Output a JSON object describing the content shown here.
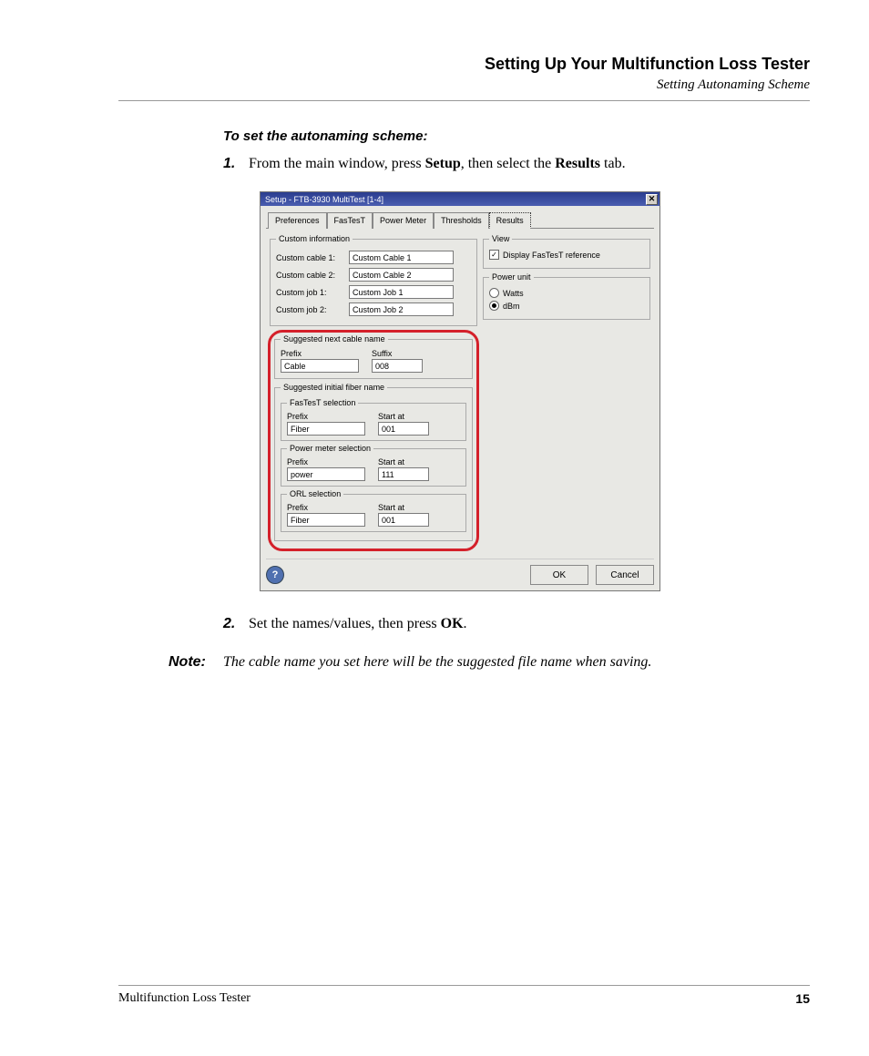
{
  "header": {
    "title": "Setting Up Your Multifunction Loss Tester",
    "subtitle": "Setting Autonaming Scheme"
  },
  "instructions": {
    "heading": "To set the autonaming scheme:",
    "step1_num": "1.",
    "step1_a": "From the main window, press ",
    "step1_b": "Setup",
    "step1_c": ", then select the ",
    "step1_d": "Results",
    "step1_e": " tab.",
    "step2_num": "2.",
    "step2_a": "Set the names/values, then press ",
    "step2_b": "OK",
    "step2_c": "."
  },
  "note": {
    "label": "Note:",
    "text": "The cable name you set here will be the suggested file name when saving."
  },
  "dialog": {
    "title": "Setup - FTB-3930 MultiTest [1-4]",
    "close_glyph": "✕",
    "tabs": [
      "Preferences",
      "FasTesT",
      "Power Meter",
      "Thresholds",
      "Results"
    ],
    "custom_info": {
      "legend": "Custom information",
      "cable1_label": "Custom cable 1:",
      "cable1_value": "Custom Cable 1",
      "cable2_label": "Custom cable 2:",
      "cable2_value": "Custom Cable 2",
      "job1_label": "Custom job 1:",
      "job1_value": "Custom Job 1",
      "job2_label": "Custom job 2:",
      "job2_value": "Custom Job 2"
    },
    "suggested_cable": {
      "legend": "Suggested next cable name",
      "prefix_label": "Prefix",
      "suffix_label": "Suffix",
      "prefix_value": "Cable",
      "suffix_value": "008"
    },
    "suggested_fiber": {
      "legend": "Suggested initial fiber name",
      "fastest": {
        "legend": "FasTesT selection",
        "prefix_label": "Prefix",
        "start_label": "Start at",
        "prefix_value": "Fiber",
        "start_value": "001"
      },
      "power": {
        "legend": "Power meter selection",
        "prefix_label": "Prefix",
        "start_label": "Start at",
        "prefix_value": "power",
        "start_value": "111"
      },
      "orl": {
        "legend": "ORL selection",
        "prefix_label": "Prefix",
        "start_label": "Start at",
        "prefix_value": "Fiber",
        "start_value": "001"
      }
    },
    "view": {
      "legend": "View",
      "checkbox_label": "Display FasTesT reference",
      "checked_glyph": "✓"
    },
    "power_unit": {
      "legend": "Power unit",
      "watts_label": "Watts",
      "dbm_label": "dBm"
    },
    "buttons": {
      "help": "?",
      "ok": "OK",
      "cancel": "Cancel"
    }
  },
  "footer": {
    "left": "Multifunction Loss Tester",
    "page": "15"
  }
}
